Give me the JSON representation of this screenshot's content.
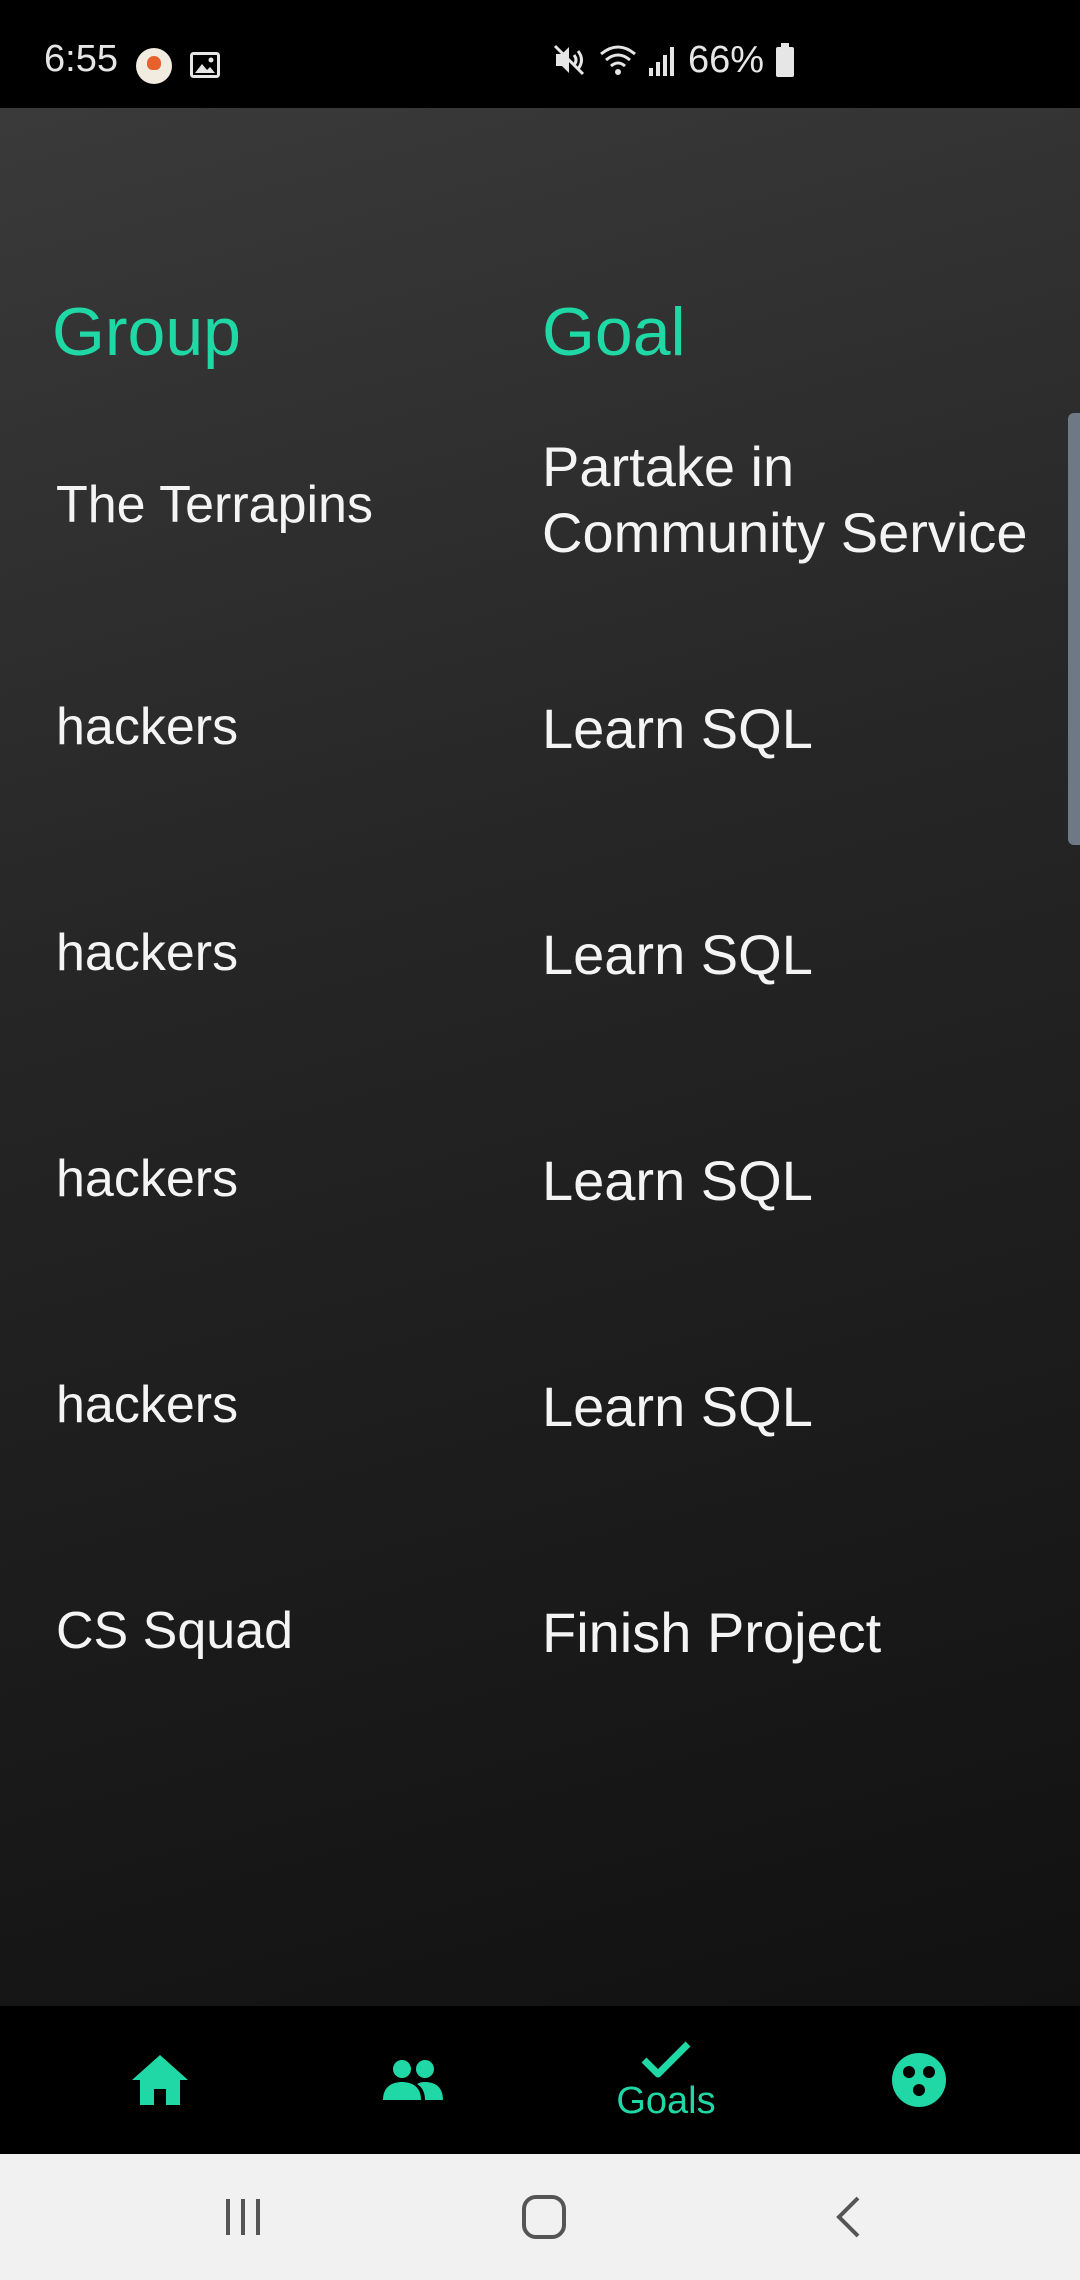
{
  "status_bar": {
    "time": "6:55",
    "battery": "66%",
    "icons": [
      "app-notification-icon",
      "gallery-icon",
      "mute-icon",
      "wifi-icon",
      "signal-icon",
      "battery-icon"
    ]
  },
  "table": {
    "headers": {
      "group": "Group",
      "goal": "Goal"
    },
    "rows": [
      {
        "group": "The Terrapins",
        "goal": "Partake in Community Service"
      },
      {
        "group": "hackers",
        "goal": "Learn SQL"
      },
      {
        "group": "hackers",
        "goal": "Learn SQL"
      },
      {
        "group": "hackers",
        "goal": "Learn SQL"
      },
      {
        "group": "hackers",
        "goal": "Learn SQL"
      },
      {
        "group": "CS Squad",
        "goal": "Finish Project"
      }
    ]
  },
  "bottom_nav": {
    "items": [
      {
        "icon": "home-icon",
        "label": ""
      },
      {
        "icon": "people-icon",
        "label": ""
      },
      {
        "icon": "check-icon",
        "label": "Goals",
        "selected": true
      },
      {
        "icon": "bubbles-icon",
        "label": ""
      }
    ]
  },
  "system_nav": {
    "icons": [
      "recents-icon",
      "home-button-icon",
      "back-icon"
    ]
  },
  "colors": {
    "accent": "#1fd8a6",
    "text": "#f4f4f4",
    "background_top": "#3a3a3a",
    "background_bottom": "#111111"
  }
}
